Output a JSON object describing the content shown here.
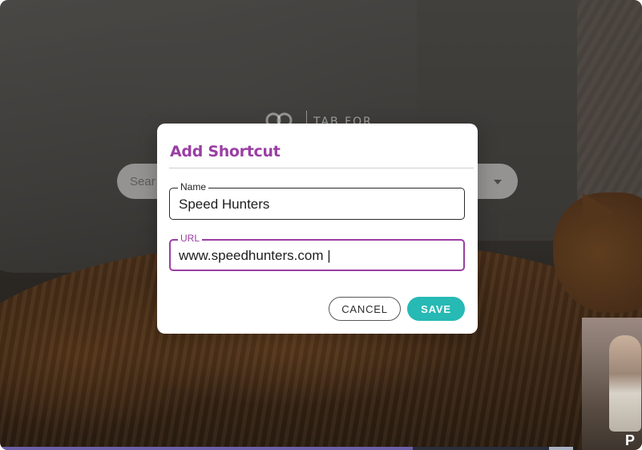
{
  "background": {
    "logo_text": "TAB FOR",
    "search_placeholder": "Sear"
  },
  "video_thumbnail": {
    "caption": "P"
  },
  "modal": {
    "title": "Add Shortcut",
    "name_field": {
      "label": "Name",
      "value": "Speed Hunters"
    },
    "url_field": {
      "label": "URL",
      "value": "www.speedhunters.com |"
    },
    "cancel_label": "CANCEL",
    "save_label": "SAVE"
  },
  "colors": {
    "accent_purple": "#9a3fa3",
    "save_teal": "#27b9b4"
  },
  "icons": {
    "logo": "tab-for-a-cause-logo-icon",
    "dropdown": "chevron-down-icon"
  }
}
